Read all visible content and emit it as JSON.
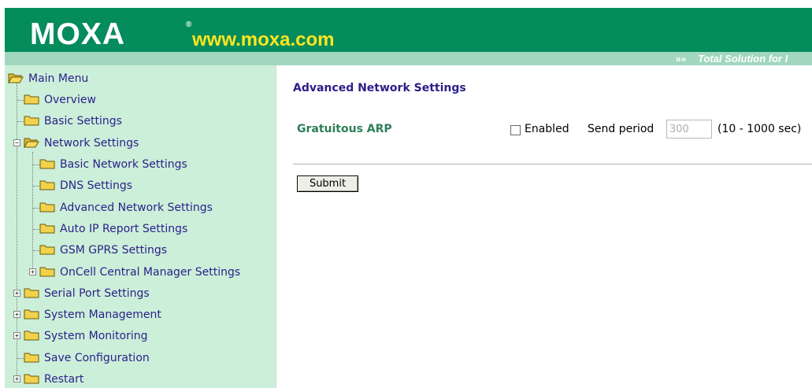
{
  "header": {
    "logo": "MOXA",
    "logo_mark": "®",
    "url": "www.moxa.com",
    "tagline_arrows": "»»",
    "tagline": "Total Solution for I"
  },
  "sidebar": {
    "items": [
      {
        "label": "Main Menu",
        "icon": "folder-open-icon"
      },
      {
        "label": "Overview",
        "icon": "folder-icon"
      },
      {
        "label": "Basic Settings",
        "icon": "folder-icon"
      },
      {
        "label": "Network Settings",
        "icon": "folder-open-icon",
        "expander": "−"
      },
      {
        "label": "Basic Network Settings",
        "icon": "folder-icon"
      },
      {
        "label": "DNS Settings",
        "icon": "folder-icon"
      },
      {
        "label": "Advanced Network Settings",
        "icon": "folder-icon"
      },
      {
        "label": "Auto IP Report Settings",
        "icon": "folder-icon"
      },
      {
        "label": "GSM GPRS Settings",
        "icon": "folder-icon"
      },
      {
        "label": "OnCell Central Manager Settings",
        "icon": "folder-icon",
        "expander": "+"
      },
      {
        "label": "Serial Port Settings",
        "icon": "folder-icon",
        "expander": "+"
      },
      {
        "label": "System Management",
        "icon": "folder-icon",
        "expander": "+"
      },
      {
        "label": "System Monitoring",
        "icon": "folder-icon",
        "expander": "+"
      },
      {
        "label": "Save Configuration",
        "icon": "folder-icon"
      },
      {
        "label": "Restart",
        "icon": "folder-icon",
        "expander": "+"
      }
    ]
  },
  "main": {
    "title": "Advanced Network Settings",
    "gratuitous_arp": {
      "label": "Gratuitous ARP",
      "enabled_label": "Enabled",
      "enabled_checked": false,
      "send_period_label": "Send period",
      "send_period_value": "300",
      "range_text": "(10 - 1000 sec)"
    },
    "submit_label": "Submit"
  },
  "colors": {
    "banner": "#048c5c",
    "banner_strip": "#a0d7be",
    "sidebar_bg": "#ccefd9",
    "link_text": "#2b1f8a",
    "field_label": "#2d7f59",
    "folder": "#f2d24a"
  }
}
